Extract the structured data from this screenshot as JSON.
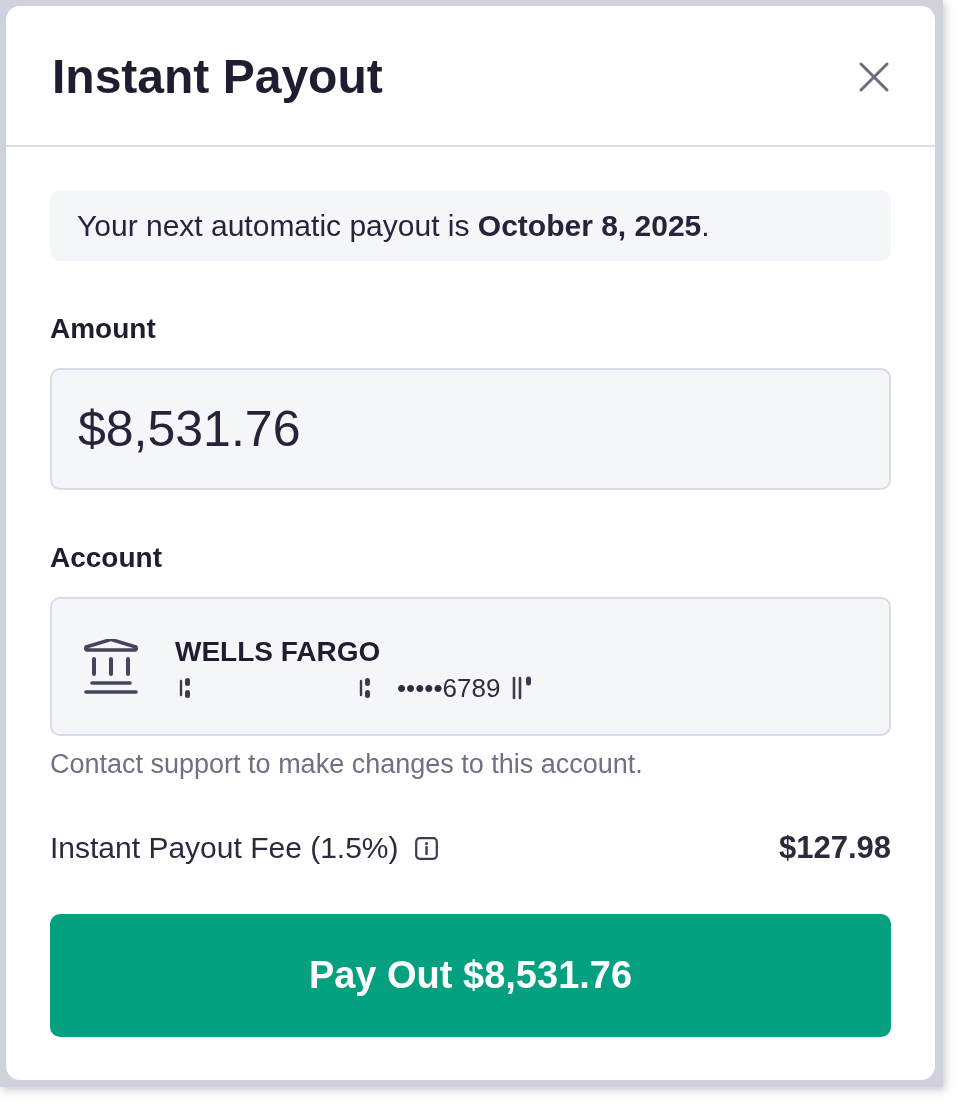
{
  "dialog": {
    "title": "Instant Payout"
  },
  "notice": {
    "text": "Your next automatic payout is **October 8, 2025**."
  },
  "amount": {
    "label": "Amount",
    "value": "$8,531.76"
  },
  "account": {
    "label": "Account",
    "bank_name": "WELLS FARGO",
    "masked_number": "•••••6789",
    "help_text": "Contact support to make changes to this account."
  },
  "fee": {
    "label": "Instant Payout Fee (1.5%)",
    "amount": "$127.98"
  },
  "button": {
    "label": "Pay Out $8,531.76"
  }
}
